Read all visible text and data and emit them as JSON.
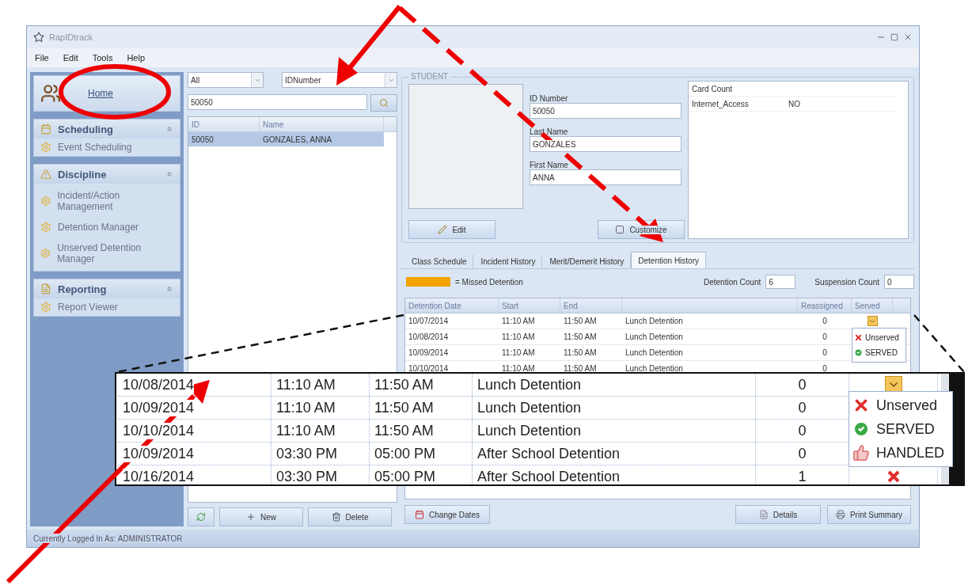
{
  "window": {
    "title": "RapIDtrack"
  },
  "menu": [
    "File",
    "Edit",
    "Tools",
    "Help"
  ],
  "sidebar": {
    "home": "Home",
    "groups": [
      {
        "title": "Scheduling",
        "expanded": true,
        "items": [
          "Event Scheduling"
        ]
      },
      {
        "title": "Discipline",
        "expanded": true,
        "items": [
          "Incident/Action Management",
          "Detention Manager",
          "Unserved Detention Manager"
        ]
      },
      {
        "title": "Reporting",
        "expanded": true,
        "items": [
          "Report Viewer"
        ]
      }
    ]
  },
  "search": {
    "filter": "All",
    "field": "IDNumber",
    "value": "50050"
  },
  "student_list": {
    "columns": {
      "id": "ID",
      "name": "Name"
    },
    "rows": [
      {
        "id": "50050",
        "name": "GONZALES, ANNA",
        "selected": true
      }
    ]
  },
  "list_buttons": [
    "New",
    "Delete"
  ],
  "student": {
    "group_title": "STUDENT",
    "fields": [
      {
        "label": "ID Number",
        "value": "50050"
      },
      {
        "label": "Last Name",
        "value": "GONZALES"
      },
      {
        "label": "First Name",
        "value": "ANNA"
      }
    ],
    "buttons": [
      "Edit",
      "Customize"
    ],
    "properties": [
      {
        "name": "Card Count"
      },
      {
        "name": "Internet_Access",
        "value": "NO"
      }
    ]
  },
  "tabs": [
    {
      "label": "Class Schedule",
      "selected": false
    },
    {
      "label": "Incident History",
      "selected": false
    },
    {
      "label": "Merit/Demerit History",
      "selected": false
    },
    {
      "label": "Detention History",
      "selected": true
    }
  ],
  "detention": {
    "legend": "= Missed Detention",
    "detention_count_label": "Detention Count",
    "detention_count": "6",
    "suspension_count_label": "Suspension Count",
    "suspension_count": "0",
    "columns": {
      "date": "Detention Date",
      "start": "Start",
      "end": "End",
      "reassigned": "Reassigned",
      "served": "Served"
    },
    "rows": [
      {
        "date": "10/07/2014",
        "start": "11:10 AM",
        "end": "11:50 AM",
        "type": "Lunch Detention",
        "reassigned": "0",
        "dropdown": true
      },
      {
        "date": "10/08/2014",
        "start": "11:10 AM",
        "end": "11:50 AM",
        "type": "Lunch Detention",
        "reassigned": "0"
      },
      {
        "date": "10/09/2014",
        "start": "11:10 AM",
        "end": "11:50 AM",
        "type": "Lunch Detention",
        "reassigned": "0"
      },
      {
        "date": "10/10/2014",
        "start": "11:10 AM",
        "end": "11:50 AM",
        "type": "Lunch Detention",
        "reassigned": "0"
      }
    ],
    "dropdown": [
      {
        "kind": "cross",
        "label": "Unserved"
      },
      {
        "kind": "check",
        "label": "SERVED"
      }
    ],
    "buttons_left": [
      "Change Dates"
    ],
    "buttons_right": [
      "Details",
      "Print Summary"
    ]
  },
  "callout": {
    "rows": [
      {
        "date": "10/08/2014",
        "start": "11:10 AM",
        "end": "11:50 AM",
        "type": "Lunch Detention",
        "reassigned": "0",
        "dropdown": true
      },
      {
        "date": "10/09/2014",
        "start": "11:10 AM",
        "end": "11:50 AM",
        "type": "Lunch Detention",
        "reassigned": "0"
      },
      {
        "date": "10/10/2014",
        "start": "11:10 AM",
        "end": "11:50 AM",
        "type": "Lunch Detention",
        "reassigned": "0"
      },
      {
        "date": "10/09/2014",
        "start": "03:30 PM",
        "end": "05:00 PM",
        "type": "After School Detention",
        "reassigned": "0"
      },
      {
        "date": "10/16/2014",
        "start": "03:30 PM",
        "end": "05:00 PM",
        "type": "After School Detention",
        "reassigned": "1",
        "unserved": true
      }
    ],
    "dropdown": [
      {
        "kind": "cross",
        "label": "Unserved"
      },
      {
        "kind": "check",
        "label": "SERVED"
      },
      {
        "kind": "thumb",
        "label": "HANDLED"
      }
    ]
  },
  "status_bar": "Currently Logged In As: ADMINISTRATOR"
}
